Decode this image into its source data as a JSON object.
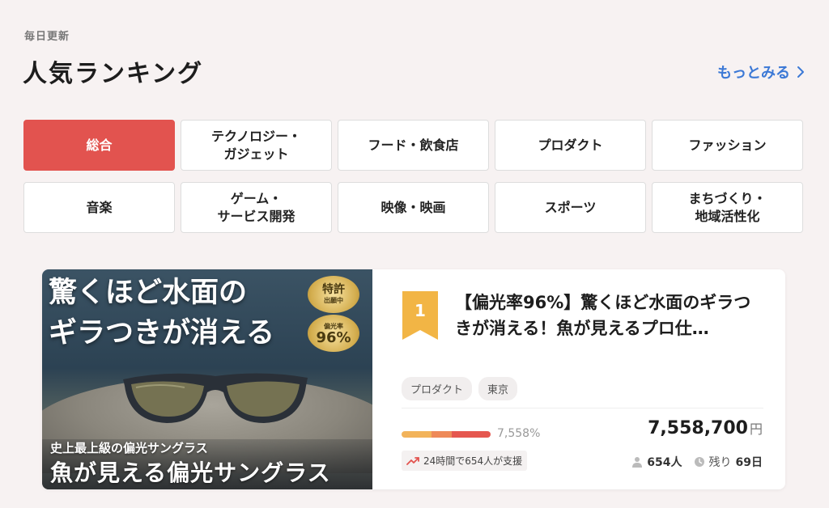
{
  "header": {
    "eyebrow": "毎日更新",
    "title": "人気ランキング",
    "more_label": "もっとみる"
  },
  "categories": [
    {
      "label": "総合",
      "active": true
    },
    {
      "label": "テクノロジー・\nガジェット",
      "active": false
    },
    {
      "label": "フード・飲食店",
      "active": false
    },
    {
      "label": "プロダクト",
      "active": false
    },
    {
      "label": "ファッション",
      "active": false
    },
    {
      "label": "音楽",
      "active": false
    },
    {
      "label": "ゲーム・\nサービス開発",
      "active": false
    },
    {
      "label": "映像・映画",
      "active": false
    },
    {
      "label": "スポーツ",
      "active": false
    },
    {
      "label": "まちづくり・\n地域活性化",
      "active": false
    }
  ],
  "project": {
    "rank": "1",
    "title": "【偏光率96%】驚くほど水面のギラつきが消える！魚が見えるプロ仕…",
    "image": {
      "headline": "驚くほど水面の\nギラつきが消える",
      "badge_patent_main": "特許",
      "badge_patent_sub": "出願中",
      "badge_rate_label": "偏光率",
      "badge_rate_value": "96%",
      "subcopy": "史上最上級の偏光サングラス",
      "bigcopy": "魚が見える偏光サングラス"
    },
    "tags": [
      "プロダクト",
      "東京"
    ],
    "percent_text": "7,558%",
    "progress_fraction": 1.0,
    "amount": "7,558,700",
    "currency": "円",
    "trend_text": "24時間で654人が支援",
    "supporters": "654人",
    "remaining_label": "残り",
    "remaining_value": "69日",
    "icons": {
      "more": "chevron-right-icon",
      "trend": "trending-up-icon",
      "supporters": "person-icon",
      "remaining": "clock-icon"
    }
  },
  "colors": {
    "accent": "#e2534f",
    "link": "#3c79d6",
    "ribbon": "#f2b545",
    "background": "#f7f2f2"
  }
}
